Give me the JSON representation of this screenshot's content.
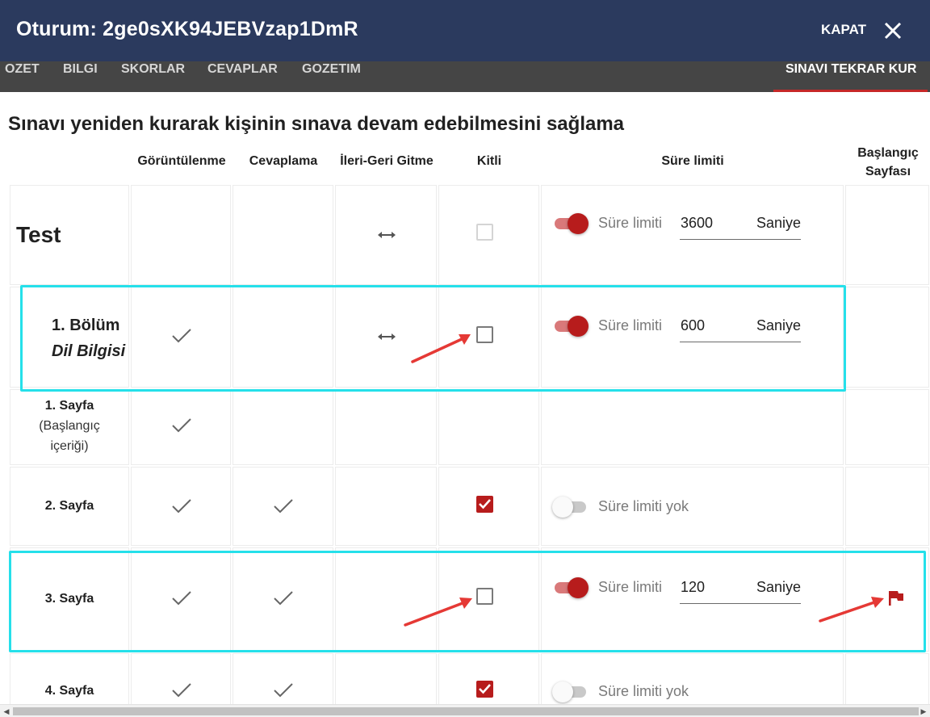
{
  "header": {
    "title": "Oturum: 2ge0sXK94JEBVzap1DmR",
    "close_label": "KAPAT",
    "close_icon": "close-icon"
  },
  "tabs": [
    {
      "label": "OZET",
      "active": false
    },
    {
      "label": "BILGI",
      "active": false
    },
    {
      "label": "SKORLAR",
      "active": false
    },
    {
      "label": "CEVAPLAR",
      "active": false
    },
    {
      "label": "GOZETIM",
      "active": false
    },
    {
      "label": "SINAVI TEKRAR KUR",
      "active": true
    }
  ],
  "page_heading": "Sınavı yeniden kurarak kişinin sınava devam edebilmesini sağlama",
  "columns": {
    "viewing": "Görüntülenme",
    "answering": "Cevaplama",
    "navigation": "İleri-Geri Gitme",
    "locked": "Kitli",
    "time_limit": "Süre limiti",
    "start_page": "Başlangıç Sayfası"
  },
  "rows": [
    {
      "title": "Test",
      "navigation_icon": "left-right-arrow-icon",
      "locked": false,
      "locked_disabled": true,
      "time_limit_on": true,
      "time_limit_label": "Süre limiti",
      "time_value": "3600",
      "time_unit": "Saniye"
    },
    {
      "title": "1. Bölüm",
      "subtitle": "Dil Bilgisi",
      "viewing": true,
      "navigation_icon": "left-right-arrow-icon",
      "locked": false,
      "time_limit_on": true,
      "time_limit_label": "Süre limiti",
      "time_value": "600",
      "time_unit": "Saniye",
      "highlighted": true
    },
    {
      "title": "1. Sayfa",
      "subtitle_lines": [
        "(Başlangıç",
        "içeriği)"
      ],
      "viewing": true
    },
    {
      "title": "2. Sayfa",
      "viewing": true,
      "answering": true,
      "locked": true,
      "time_limit_on": false,
      "time_limit_label": "Süre limiti yok"
    },
    {
      "title": "3. Sayfa",
      "viewing": true,
      "answering": true,
      "locked": false,
      "time_limit_on": true,
      "time_limit_label": "Süre limiti",
      "time_value": "120",
      "time_unit": "Saniye",
      "start_page": true,
      "start_page_icon": "flag-icon",
      "highlighted": true
    },
    {
      "title": "4. Sayfa",
      "viewing": true,
      "answering": true,
      "locked": true,
      "time_limit_on": false,
      "time_limit_label": "Süre limiti yok"
    }
  ],
  "colors": {
    "header_bg": "#2b3a5e",
    "tabs_bg": "#454545",
    "accent_red": "#b71c1c",
    "highlight_cyan": "#25e0ea",
    "annotation_arrow": "#e53935"
  }
}
